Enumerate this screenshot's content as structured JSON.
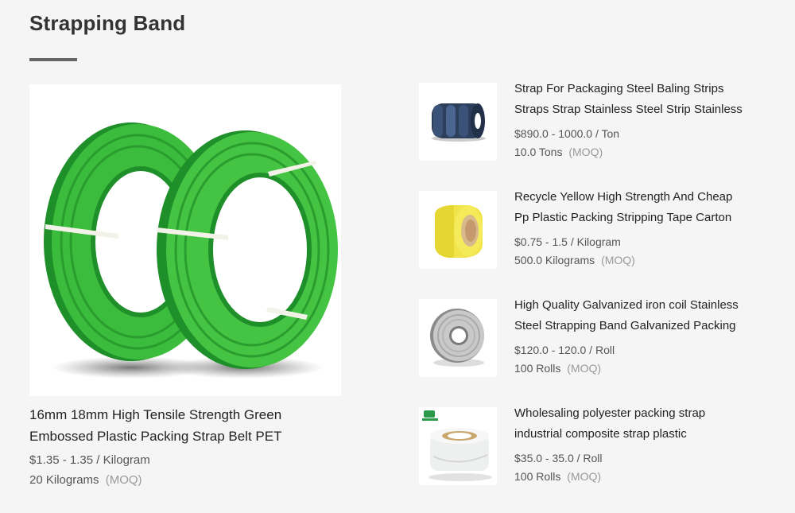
{
  "section": {
    "title": "Strapping Band"
  },
  "featured": {
    "image_icon": "green-pet-strap-coils",
    "title_line1": "16mm 18mm High Tensile Strength Green",
    "title_line2": "Embossed Plastic Packing Strap Belt PET",
    "price": "$1.35 - 1.35 / Kilogram",
    "moq": "20 Kilograms",
    "moq_tag": "(MOQ)"
  },
  "items": [
    {
      "image_icon": "steel-strap-coil",
      "title_line1": "Strap For Packaging Steel Baling Strips",
      "title_line2": "Straps Strap Stainless Steel Strip Stainless",
      "price": "$890.0 - 1000.0 / Ton",
      "moq": "10.0 Tons",
      "moq_tag": "(MOQ)"
    },
    {
      "image_icon": "yellow-pp-strap-roll",
      "title_line1": "Recycle Yellow High Strength And Cheap",
      "title_line2": "Pp Plastic Packing Stripping Tape Carton",
      "price": "$0.75 - 1.5 / Kilogram",
      "moq": "500.0 Kilograms",
      "moq_tag": "(MOQ)"
    },
    {
      "image_icon": "galvanized-steel-coil",
      "title_line1": "High Quality Galvanized iron coil Stainless",
      "title_line2": "Steel Strapping Band Galvanized Packing",
      "price": "$120.0 - 120.0 / Roll",
      "moq": "100 Rolls",
      "moq_tag": "(MOQ)"
    },
    {
      "image_icon": "white-polyester-strap-roll",
      "title_line1": "Wholesaling polyester packing strap",
      "title_line2": "industrial composite strap plastic",
      "price": "$35.0 - 35.0 / Roll",
      "moq": "100 Rolls",
      "moq_tag": "(MOQ)"
    }
  ]
}
